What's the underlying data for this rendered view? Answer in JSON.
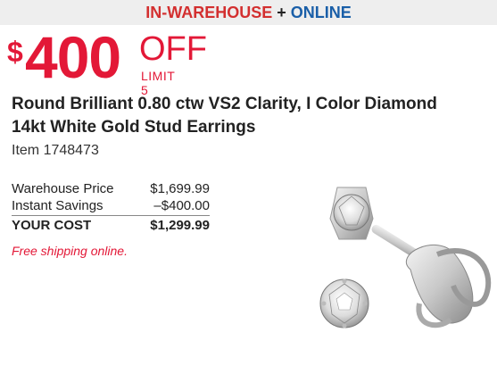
{
  "banner": {
    "in_warehouse": "IN-WAREHOUSE",
    "plus": " + ",
    "online": "ONLINE"
  },
  "offer": {
    "currency": "$",
    "amount": "400",
    "off": "OFF",
    "limit": "LIMIT 5"
  },
  "product": {
    "title": "Round Brilliant 0.80 ctw VS2 Clarity, I Color Diamond 14kt White Gold Stud Earrings",
    "item_number": "Item 1748473",
    "image_icon": "diamond-stud-earrings"
  },
  "pricing": {
    "warehouse_label": "Warehouse Price",
    "warehouse_value": "$1,699.99",
    "savings_label": "Instant Savings",
    "savings_value": "–$400.00",
    "cost_label": "YOUR COST",
    "cost_value": "$1,299.99"
  },
  "shipping": "Free shipping online.",
  "colors": {
    "accent_red": "#e31837",
    "online_blue": "#1a5fa8",
    "banner_bg": "#eeeeee"
  }
}
